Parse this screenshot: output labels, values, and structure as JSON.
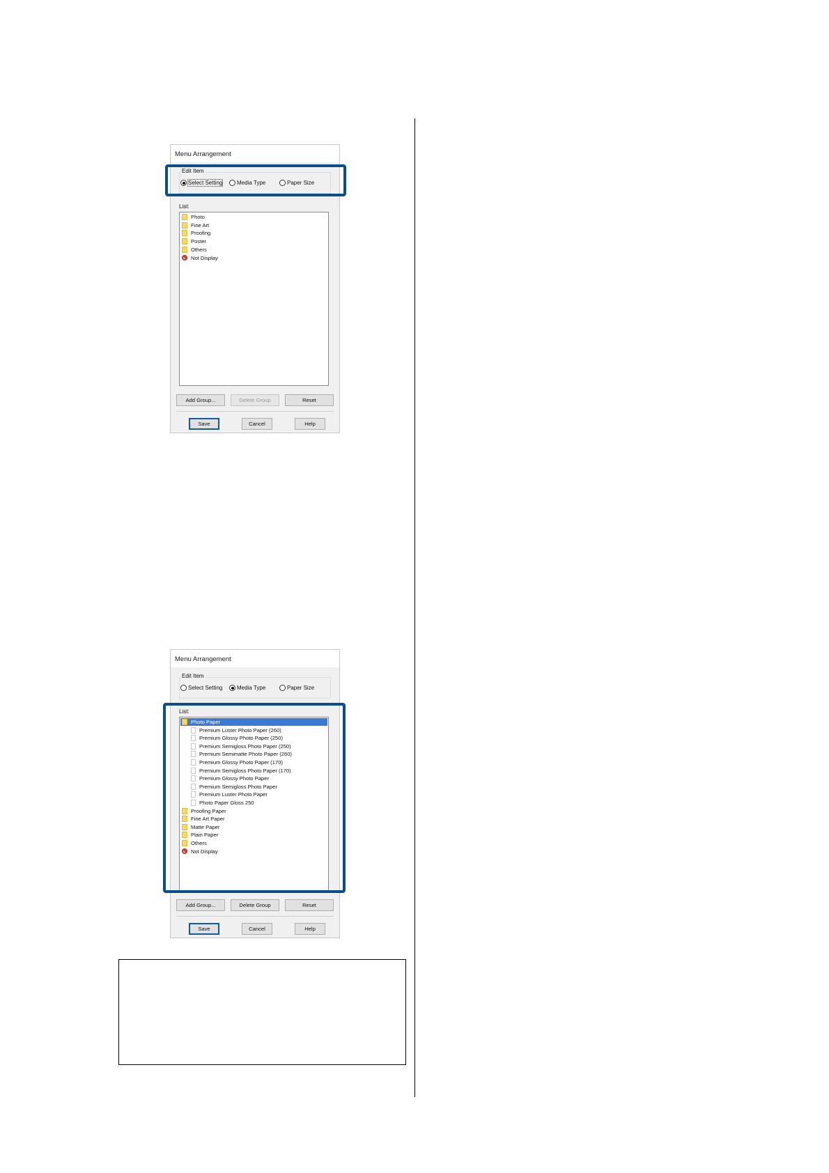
{
  "dialog1": {
    "title": "Menu Arrangement",
    "edit_item_label": "Edit Item",
    "radios": [
      {
        "label": "Select Setting",
        "selected": true
      },
      {
        "label": "Media Type",
        "selected": false
      },
      {
        "label": "Paper Size",
        "selected": false
      }
    ],
    "list_label": "List:",
    "items": [
      {
        "label": "Photo",
        "icon": "folder-icon"
      },
      {
        "label": "Fine Art",
        "icon": "folder-icon"
      },
      {
        "label": "Proofing",
        "icon": "folder-icon"
      },
      {
        "label": "Poster",
        "icon": "folder-icon"
      },
      {
        "label": "Others",
        "icon": "folder-icon"
      },
      {
        "label": "Not Display",
        "icon": "no-entry-icon"
      }
    ],
    "buttons": {
      "add_group": "Add Group...",
      "delete_group": "Delete Group",
      "reset": "Reset",
      "save": "Save",
      "cancel": "Cancel",
      "help": "Help"
    }
  },
  "dialog2": {
    "title": "Menu Arrangement",
    "edit_item_label": "Edit Item",
    "radios": [
      {
        "label": "Select Setting",
        "selected": false
      },
      {
        "label": "Media Type",
        "selected": true
      },
      {
        "label": "Paper Size",
        "selected": false
      }
    ],
    "list_label": "List:",
    "items": [
      {
        "label": "Photo Paper",
        "icon": "folder-icon",
        "selected": true
      },
      {
        "label": "Premium Luster Photo Paper (260)",
        "icon": "paper-icon"
      },
      {
        "label": "Premium Glossy Photo Paper (250)",
        "icon": "paper-icon"
      },
      {
        "label": "Premium Semigloss Photo Paper (250)",
        "icon": "paper-icon"
      },
      {
        "label": "Premium Semimatte Photo Paper (260)",
        "icon": "paper-icon"
      },
      {
        "label": "Premium Glossy Photo Paper (170)",
        "icon": "paper-icon"
      },
      {
        "label": "Premium Semigloss Photo Paper (170)",
        "icon": "paper-icon"
      },
      {
        "label": "Premium Glossy Photo Paper",
        "icon": "paper-icon"
      },
      {
        "label": "Premium Semigloss Photo Paper",
        "icon": "paper-icon"
      },
      {
        "label": "Premium Luster Photo Paper",
        "icon": "paper-icon"
      },
      {
        "label": "Photo Paper Gloss 250",
        "icon": "paper-icon"
      },
      {
        "label": "Proofing Paper",
        "icon": "folder-icon"
      },
      {
        "label": "Fine Art Paper",
        "icon": "folder-icon"
      },
      {
        "label": "Matte Paper",
        "icon": "folder-icon"
      },
      {
        "label": "Plain Paper",
        "icon": "folder-icon"
      },
      {
        "label": "Others",
        "icon": "folder-icon"
      },
      {
        "label": "Not Display",
        "icon": "no-entry-icon"
      }
    ],
    "buttons": {
      "add_group": "Add Group...",
      "delete_group": "Delete Group",
      "reset": "Reset",
      "save": "Save",
      "cancel": "Cancel",
      "help": "Help"
    }
  },
  "colors": {
    "highlight": "#0b4f8a",
    "selection": "#3b79d4"
  }
}
